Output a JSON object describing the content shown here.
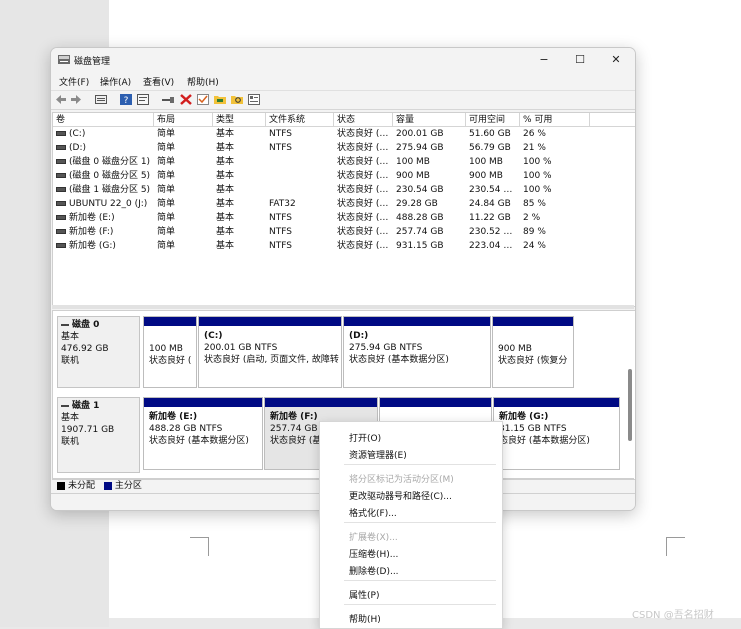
{
  "window": {
    "title": "磁盘管理",
    "controls": [
      "−",
      "☐",
      "✕"
    ]
  },
  "menubar": [
    "文件(F)",
    "操作(A)",
    "查看(V)",
    "帮助(H)"
  ],
  "toolbar": [
    "back-icon",
    "forward-icon",
    "disk-list-icon",
    "help-icon",
    "properties-icon",
    "connect-icon",
    "delete-icon",
    "check-icon",
    "folder-icon",
    "search-icon",
    "view-icon"
  ],
  "volumes": {
    "columns": [
      "卷",
      "布局",
      "类型",
      "文件系统",
      "状态",
      "容量",
      "可用空间",
      "% 可用"
    ],
    "rows": [
      [
        "(C:)",
        "简单",
        "基本",
        "NTFS",
        "状态良好 (…",
        "200.01 GB",
        "51.60 GB",
        "26 %"
      ],
      [
        "(D:)",
        "简单",
        "基本",
        "NTFS",
        "状态良好 (…",
        "275.94 GB",
        "56.79 GB",
        "21 %"
      ],
      [
        "(磁盘 0 磁盘分区 1)",
        "简单",
        "基本",
        "",
        "状态良好 (…",
        "100 MB",
        "100 MB",
        "100 %"
      ],
      [
        "(磁盘 0 磁盘分区 5)",
        "简单",
        "基本",
        "",
        "状态良好 (…",
        "900 MB",
        "900 MB",
        "100 %"
      ],
      [
        "(磁盘 1 磁盘分区 5)",
        "简单",
        "基本",
        "",
        "状态良好 (…",
        "230.54 GB",
        "230.54 …",
        "100 %"
      ],
      [
        "UBUNTU 22_0 (J:)",
        "简单",
        "基本",
        "FAT32",
        "状态良好 (…",
        "29.28 GB",
        "24.84 GB",
        "85 %"
      ],
      [
        "新加卷 (E:)",
        "简单",
        "基本",
        "NTFS",
        "状态良好 (…",
        "488.28 GB",
        "11.22 GB",
        "2 %"
      ],
      [
        "新加卷 (F:)",
        "简单",
        "基本",
        "NTFS",
        "状态良好 (…",
        "257.74 GB",
        "230.52 …",
        "89 %"
      ],
      [
        "新加卷 (G:)",
        "简单",
        "基本",
        "NTFS",
        "状态良好 (…",
        "931.15 GB",
        "223.04 …",
        "24 %"
      ]
    ]
  },
  "disks": [
    {
      "name": "磁盘 0",
      "kind": "基本",
      "size": "476.92 GB",
      "state": "联机",
      "partitions": [
        {
          "label": "",
          "size": "100 MB",
          "status": "状态良好 ("
        },
        {
          "label": "(C:)",
          "size": "200.01 GB NTFS",
          "status": "状态良好 (启动, 页面文件, 故障转"
        },
        {
          "label": "(D:)",
          "size": "275.94 GB NTFS",
          "status": "状态良好 (基本数据分区)"
        },
        {
          "label": "",
          "size": "900 MB",
          "status": "状态良好 (恢复分"
        }
      ]
    },
    {
      "name": "磁盘 1",
      "kind": "基本",
      "size": "1907.71 GB",
      "state": "联机",
      "partitions": [
        {
          "label": "新加卷 (E:)",
          "size": "488.28 GB NTFS",
          "status": "状态良好 (基本数据分区)"
        },
        {
          "label": "新加卷 (F:)",
          "size": "257.74 GB N",
          "status": "状态良好 (基"
        },
        {
          "label": "",
          "size": "",
          "status": ""
        },
        {
          "label": "新加卷 (G:)",
          "size": "31.15 GB NTFS",
          "status": "态良好 (基本数据分区)"
        }
      ]
    }
  ],
  "legend": [
    {
      "label": "未分配",
      "color": "#000000"
    },
    {
      "label": "主分区",
      "color": "#000a84"
    }
  ],
  "context_menu": {
    "groups": [
      [
        {
          "label": "打开(O)",
          "enabled": true
        },
        {
          "label": "资源管理器(E)",
          "enabled": true
        }
      ],
      [
        {
          "label": "将分区标记为活动分区(M)",
          "enabled": false
        },
        {
          "label": "更改驱动器号和路径(C)...",
          "enabled": true
        },
        {
          "label": "格式化(F)...",
          "enabled": true
        }
      ],
      [
        {
          "label": "扩展卷(X)...",
          "enabled": false
        },
        {
          "label": "压缩卷(H)...",
          "enabled": true
        },
        {
          "label": "删除卷(D)...",
          "enabled": true
        }
      ],
      [
        {
          "label": "属性(P)",
          "enabled": true
        }
      ],
      [
        {
          "label": "帮助(H)",
          "enabled": true
        }
      ]
    ]
  },
  "watermark": "CSDN @吾名招财"
}
